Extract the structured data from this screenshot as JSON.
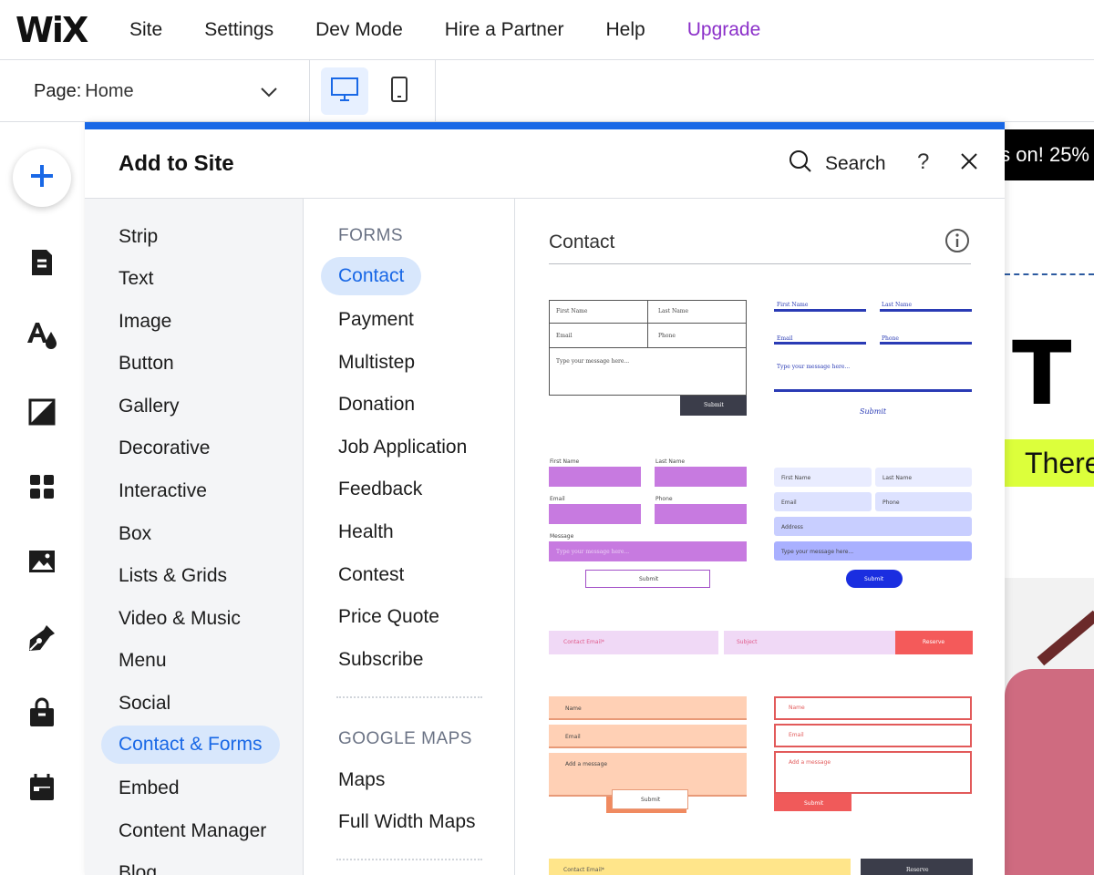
{
  "brand": {
    "logo": "WiX",
    "accent": "#1968e6",
    "upgrade_color": "#8b2fc9"
  },
  "topnav": {
    "items": [
      "Site",
      "Settings",
      "Dev Mode",
      "Hire a Partner",
      "Help"
    ],
    "upgrade": "Upgrade"
  },
  "page_selector": {
    "label": "Page:",
    "value": "Home"
  },
  "devices": {
    "desktop": "desktop-icon",
    "mobile": "mobile-icon"
  },
  "rail": [
    "add-icon",
    "pages-icon",
    "theme-icon",
    "background-icon",
    "apps-icon",
    "media-icon",
    "pen-icon",
    "store-icon",
    "bookings-icon"
  ],
  "panel": {
    "title": "Add to Site",
    "search_label": "Search",
    "help": "?",
    "categories": [
      "Strip",
      "Text",
      "Image",
      "Button",
      "Gallery",
      "Decorative",
      "Interactive",
      "Box",
      "Lists & Grids",
      "Video & Music",
      "Menu",
      "Social",
      "Contact & Forms",
      "Embed",
      "Content Manager",
      "Blog"
    ],
    "active_category": "Contact & Forms",
    "sections": [
      {
        "heading": "FORMS",
        "items": [
          "Contact",
          "Payment",
          "Multistep",
          "Donation",
          "Job Application",
          "Feedback",
          "Health",
          "Contest",
          "Price Quote",
          "Subscribe"
        ]
      },
      {
        "heading": "GOOGLE MAPS",
        "items": [
          "Maps",
          "Full Width Maps"
        ]
      }
    ],
    "active_item": "Contact",
    "preview_title": "Contact"
  },
  "thumbs": {
    "t1": {
      "first": "First Name",
      "last": "Last Name",
      "email": "Email",
      "phone": "Phone",
      "message": "Type your message here...",
      "submit": "Submit"
    },
    "t2": {
      "first": "First Name",
      "last": "Last Name",
      "email": "Email",
      "phone": "Phone",
      "message": "Type your message here...",
      "submit": "Submit"
    },
    "t3": {
      "first": "First Name",
      "last": "Last Name",
      "email": "Email",
      "phone": "Phone",
      "message": "Message",
      "message_placeholder": "Type your message here...",
      "submit": "Submit"
    },
    "t4": {
      "first": "First Name",
      "last": "Last Name",
      "email": "Email",
      "phone": "Phone",
      "address": "Address",
      "message": "Type your message here...",
      "submit": "Submit"
    },
    "t5": {
      "contact_email": "Contact Email*",
      "subject": "Subject",
      "reserve": "Reserve"
    },
    "t6": {
      "name": "Name",
      "email": "Email",
      "message": "Add a message",
      "submit": "Submit"
    },
    "t7": {
      "name": "Name",
      "email": "Email",
      "message": "Add a message",
      "submit": "Submit"
    },
    "t8": {
      "contact_email": "Contact Email*",
      "reserve": "Reserve"
    }
  },
  "canvas": {
    "promo": "s on! 25%",
    "letter": "T",
    "tagline": "There"
  }
}
